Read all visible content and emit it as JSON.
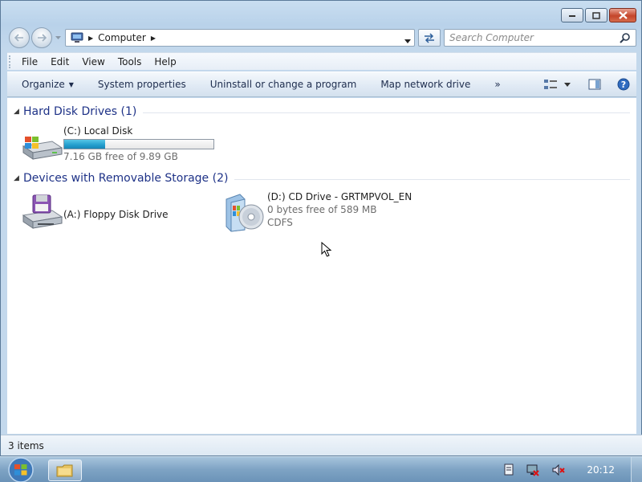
{
  "window": {
    "controls": {
      "minimize_icon": "minimize-icon",
      "maximize_icon": "maximize-icon",
      "close_icon": "close-icon"
    }
  },
  "address_bar": {
    "location_icon": "computer-icon",
    "crumbs": [
      {
        "label": "Computer"
      }
    ]
  },
  "search": {
    "placeholder": "Search Computer",
    "icon": "search-icon"
  },
  "menu": {
    "items": [
      {
        "label": "File"
      },
      {
        "label": "Edit"
      },
      {
        "label": "View"
      },
      {
        "label": "Tools"
      },
      {
        "label": "Help"
      }
    ]
  },
  "commands": {
    "organize": "Organize",
    "system_properties": "System properties",
    "uninstall": "Uninstall or change a program",
    "map_drive": "Map network drive",
    "more": "»"
  },
  "groups": {
    "hard_disks": {
      "label": "Hard Disk Drives (1)",
      "drives": [
        {
          "name": "(C:) Local Disk",
          "free_text": "7.16 GB free of 9.89 GB",
          "used_fraction": 0.276,
          "icon": "hard-disk-icon"
        }
      ]
    },
    "removable": {
      "label": "Devices with Removable Storage (2)",
      "drives": [
        {
          "name": "(A:) Floppy Disk Drive",
          "icon": "floppy-drive-icon"
        },
        {
          "name": "(D:) CD Drive - GRTMPVOL_EN",
          "free_text": "0 bytes free of 589 MB",
          "filesystem": "CDFS",
          "icon": "cd-drive-icon"
        }
      ]
    }
  },
  "status": {
    "items_text": "3 items"
  },
  "taskbar": {
    "clock": "20:12",
    "start_icon": "windows-start-icon",
    "pinned": [
      {
        "icon": "folder-icon"
      }
    ],
    "tray": [
      {
        "icon": "action-center-icon"
      },
      {
        "icon": "network-icon"
      },
      {
        "icon": "volume-muted-icon"
      }
    ]
  },
  "colors": {
    "group_header": "#1e3287",
    "capacity_fill": "#25a0cf"
  }
}
